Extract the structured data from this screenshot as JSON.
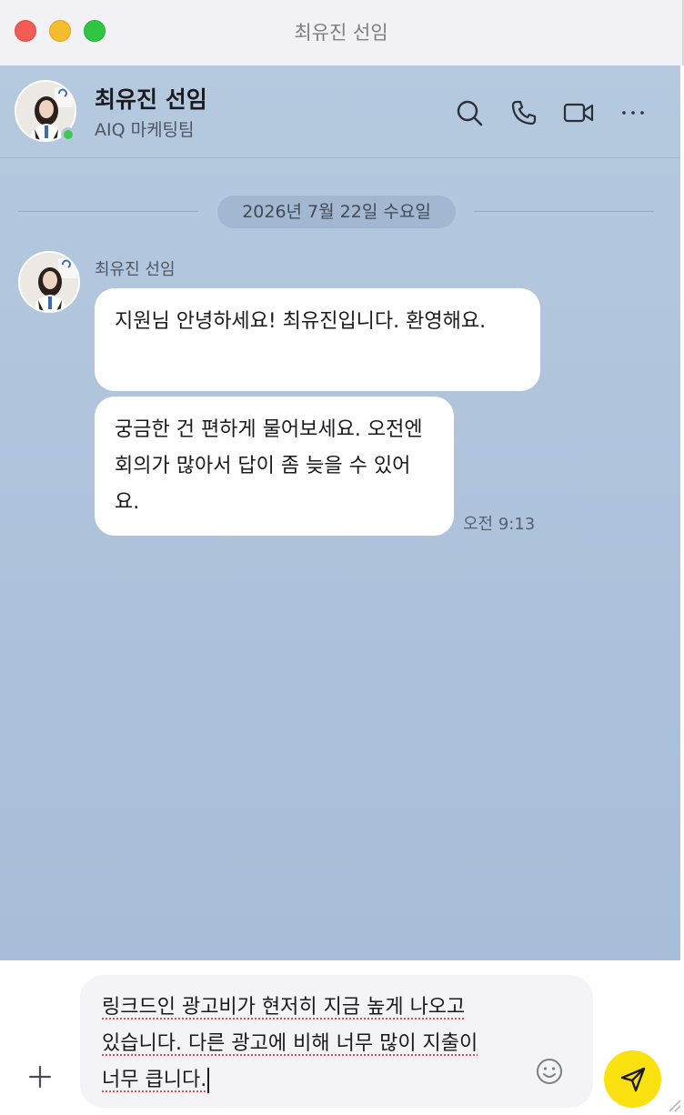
{
  "window": {
    "title": "최유진 선임"
  },
  "header": {
    "name": "최유진 선임",
    "team": "AIQ 마케팅팀",
    "status": "online",
    "actions": [
      "search-icon",
      "phone-icon",
      "video-icon",
      "more-icon"
    ]
  },
  "date_divider": "2026년 7월 22일 수요일",
  "messages": [
    {
      "sender": "최유진 선임",
      "time": "오전 9:13",
      "bubbles": [
        "지원님 안녕하세요! 최유진입니다. 환영해요.",
        "궁금한 건 편하게 물어보세요. 오전엔 회의가 많아서 답이 좀 늦을 수 있어요."
      ]
    }
  ],
  "composer": {
    "text_lines": [
      "링크드인 광고비가 현저히 지금 높게 나오고",
      "있습니다. 다른 광고에 비해 너무 많이 지출이",
      "너무 큽니다."
    ]
  },
  "colors": {
    "chat_background": "#b5c9df",
    "bubble": "#ffffff",
    "send_button": "#fbe10f",
    "online": "#3ec94e",
    "close": "#f25c54",
    "minimize": "#f7bb2e",
    "zoom": "#2fc643"
  }
}
